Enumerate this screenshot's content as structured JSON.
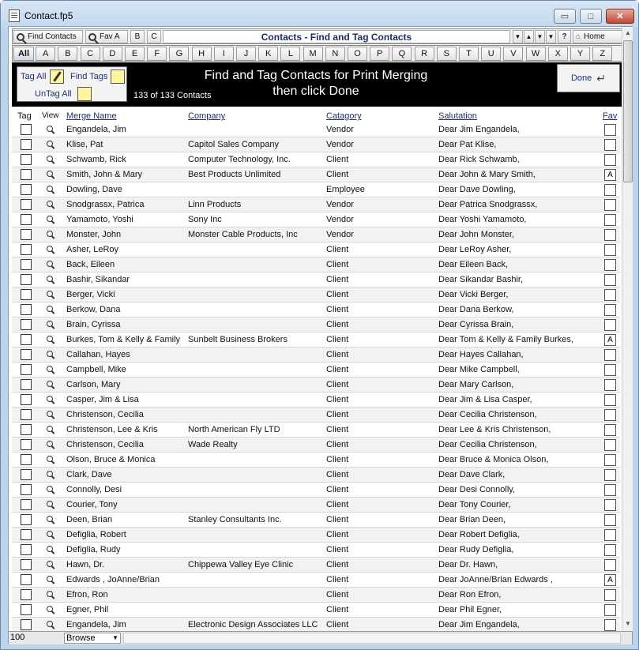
{
  "window": {
    "title": "Contact.fp5",
    "minimize": "▭",
    "maximize": "□",
    "close": "✕"
  },
  "toolbar": {
    "find_contacts": "Find Contacts",
    "fav_a": "Fav A",
    "b": "B",
    "c": "C",
    "title": "Contacts - Find and Tag Contacts",
    "home": "Home",
    "help": "?",
    "nav_first": "▼",
    "nav_up": "▲",
    "nav_down": "▼",
    "nav_last": "▼"
  },
  "alphabet": [
    "All",
    "A",
    "B",
    "C",
    "D",
    "E",
    "F",
    "G",
    "H",
    "I",
    "J",
    "K",
    "L",
    "M",
    "N",
    "O",
    "P",
    "Q",
    "R",
    "S",
    "T",
    "U",
    "V",
    "W",
    "X",
    "Y",
    "Z"
  ],
  "header": {
    "tag_all": "Tag All",
    "find_tags": "Find Tags",
    "untag_all": "UnTag All",
    "count": "133 of 133 Contacts",
    "banner_line1": "Find and Tag Contacts for Print Merging",
    "banner_line2": "then click Done",
    "done": "Done"
  },
  "columns": {
    "tag": "Tag",
    "view": "View",
    "merge_name": "Merge Name",
    "company": "Company",
    "category": "Catagory",
    "salutation": "Salutation",
    "fav": "Fav"
  },
  "rows": [
    {
      "name": "Engandela, Jim",
      "company": "",
      "category": "Vendor",
      "salutation": "Dear Jim Engandela,",
      "fav": ""
    },
    {
      "name": "Klise, Pat",
      "company": "Capitol Sales Company",
      "category": "Vendor",
      "salutation": "Dear Pat Klise,",
      "fav": ""
    },
    {
      "name": "Schwamb, Rick",
      "company": "Computer Technology, Inc.",
      "category": "Client",
      "salutation": "Dear Rick Schwamb,",
      "fav": ""
    },
    {
      "name": "Smith, John & Mary",
      "company": "Best Products Unlimited",
      "category": "Client",
      "salutation": "Dear John & Mary Smith,",
      "fav": "A"
    },
    {
      "name": "Dowling, Dave",
      "company": "",
      "category": "Employee",
      "salutation": "Dear Dave Dowling,",
      "fav": ""
    },
    {
      "name": "Snodgrassx, Patrica",
      "company": "Linn Products",
      "category": "Vendor",
      "salutation": "Dear Patrica  Snodgrassx,",
      "fav": ""
    },
    {
      "name": "Yamamoto, Yoshi",
      "company": "Sony Inc",
      "category": "Vendor",
      "salutation": "Dear Yoshi Yamamoto,",
      "fav": ""
    },
    {
      "name": "Monster, John",
      "company": "Monster Cable Products, Inc",
      "category": "Vendor",
      "salutation": "Dear John Monster,",
      "fav": ""
    },
    {
      "name": "Asher, LeRoy",
      "company": "",
      "category": "Client",
      "salutation": "Dear LeRoy Asher,",
      "fav": ""
    },
    {
      "name": "Back, Eileen",
      "company": "",
      "category": "Client",
      "salutation": "Dear Eileen Back,",
      "fav": ""
    },
    {
      "name": "Bashir, Sikandar",
      "company": "",
      "category": "Client",
      "salutation": "Dear Sikandar Bashir,",
      "fav": ""
    },
    {
      "name": "Berger, Vicki",
      "company": "",
      "category": "Client",
      "salutation": "Dear Vicki Berger,",
      "fav": ""
    },
    {
      "name": "Berkow, Dana",
      "company": "",
      "category": "Client",
      "salutation": "Dear Dana Berkow,",
      "fav": ""
    },
    {
      "name": "Brain, Cyrissa",
      "company": "",
      "category": "Client",
      "salutation": "Dear Cyrissa Brain,",
      "fav": ""
    },
    {
      "name": "Burkes, Tom & Kelly & Family",
      "company": "Sunbelt Business Brokers",
      "category": "Client",
      "salutation": "Dear Tom & Kelly & Family Burkes,",
      "fav": "A"
    },
    {
      "name": "Callahan, Hayes",
      "company": "",
      "category": "Client",
      "salutation": "Dear Hayes Callahan,",
      "fav": ""
    },
    {
      "name": "Campbell, Mike",
      "company": "",
      "category": "Client",
      "salutation": "Dear Mike Campbell,",
      "fav": ""
    },
    {
      "name": "Carlson, Mary",
      "company": "",
      "category": "Client",
      "salutation": "Dear Mary Carlson,",
      "fav": ""
    },
    {
      "name": "Casper, Jim & Lisa",
      "company": "",
      "category": "Client",
      "salutation": "Dear Jim & Lisa Casper,",
      "fav": ""
    },
    {
      "name": "Christenson, Cecilia",
      "company": "",
      "category": "Client",
      "salutation": "Dear Cecilia Christenson,",
      "fav": ""
    },
    {
      "name": "Christenson, Lee & Kris",
      "company": "North American Fly LTD",
      "category": "Client",
      "salutation": "Dear Lee & Kris Christenson,",
      "fav": ""
    },
    {
      "name": "Christenson, Cecilia",
      "company": "Wade Realty",
      "category": "Client",
      "salutation": "Dear Cecilia Christenson,",
      "fav": ""
    },
    {
      "name": "Olson, Bruce & Monica",
      "company": "",
      "category": "Client",
      "salutation": "Dear Bruce & Monica Olson,",
      "fav": ""
    },
    {
      "name": "Clark, Dave",
      "company": "",
      "category": "Client",
      "salutation": "Dear Dave Clark,",
      "fav": ""
    },
    {
      "name": "Connolly, Desi",
      "company": "",
      "category": "Client",
      "salutation": "Dear Desi Connolly,",
      "fav": ""
    },
    {
      "name": "Courier, Tony",
      "company": "",
      "category": "Client",
      "salutation": "Dear Tony Courier,",
      "fav": ""
    },
    {
      "name": "Deen, Brian",
      "company": "Stanley Consultants Inc.",
      "category": "Client",
      "salutation": "Dear Brian Deen,",
      "fav": ""
    },
    {
      "name": "Defiglia, Robert",
      "company": "",
      "category": "Client",
      "salutation": "Dear Robert Defiglia,",
      "fav": ""
    },
    {
      "name": "Defiglia, Rudy",
      "company": "",
      "category": "Client",
      "salutation": "Dear Rudy Defiglia,",
      "fav": ""
    },
    {
      "name": "Hawn, Dr.",
      "company": "Chippewa Valley Eye Clinic",
      "category": "Client",
      "salutation": "Dear Dr. Hawn,",
      "fav": ""
    },
    {
      "name": "Edwards , JoAnne/Brian",
      "company": "",
      "category": "Client",
      "salutation": "Dear JoAnne/Brian Edwards ,",
      "fav": "A"
    },
    {
      "name": "Efron, Ron",
      "company": "",
      "category": "Client",
      "salutation": "Dear Ron Efron,",
      "fav": ""
    },
    {
      "name": "Egner, Phil",
      "company": "",
      "category": "Client",
      "salutation": "Dear Phil Egner,",
      "fav": ""
    },
    {
      "name": "Engandela, Jim",
      "company": "Electronic Design Associates LLC",
      "category": "Client",
      "salutation": "Dear Jim Engandela,",
      "fav": ""
    }
  ],
  "status": {
    "zoom": "100",
    "mode": "Browse"
  }
}
